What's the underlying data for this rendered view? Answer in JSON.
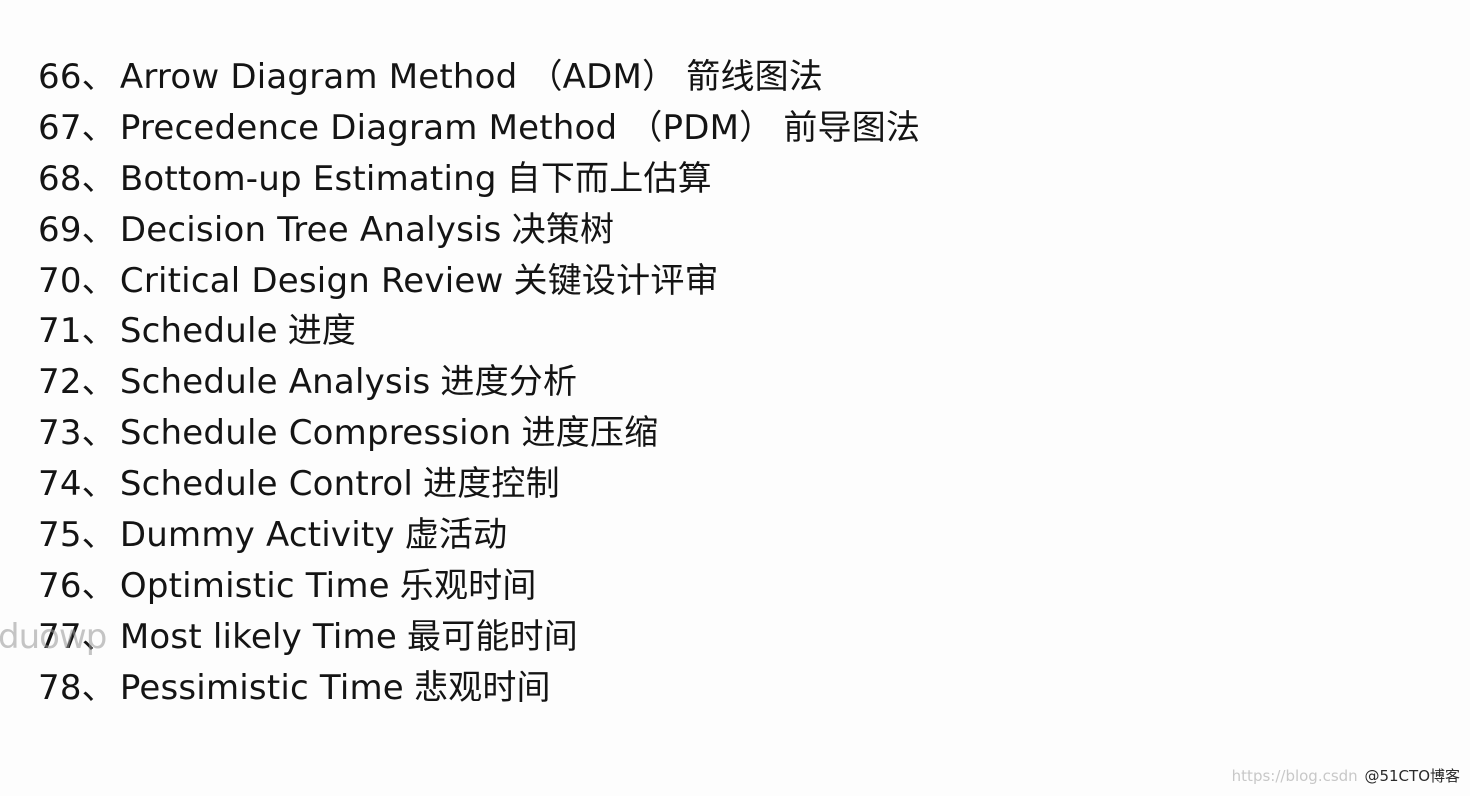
{
  "terms": [
    {
      "num": "66",
      "sep": "、",
      "en": "Arrow Diagram Method （ADM）",
      "zh": "箭线图法"
    },
    {
      "num": "67",
      "sep": "、",
      "en": "Precedence Diagram Method （PDM）",
      "zh": "前导图法"
    },
    {
      "num": "68",
      "sep": "、",
      "en": "Bottom-up Estimating",
      "zh": "自下而上估算"
    },
    {
      "num": "69",
      "sep": "、",
      "en": "Decision Tree Analysis",
      "zh": "决策树"
    },
    {
      "num": "70",
      "sep": "、",
      "en": "Critical Design Review",
      "zh": "关键设计评审"
    },
    {
      "num": "71",
      "sep": "、",
      "en": "Schedule",
      "zh": "进度"
    },
    {
      "num": "72",
      "sep": "、",
      "en": "Schedule Analysis",
      "zh": "进度分析"
    },
    {
      "num": "73",
      "sep": "、",
      "en": "Schedule Compression",
      "zh": "进度压缩"
    },
    {
      "num": "74",
      "sep": "、",
      "en": "Schedule Control",
      "zh": "进度控制"
    },
    {
      "num": "75",
      "sep": "、",
      "en": "Dummy Activity",
      "zh": "虚活动"
    },
    {
      "num": "76",
      "sep": "、",
      "en": "Optimistic Time",
      "zh": "乐观时间"
    },
    {
      "num": "77",
      "sep": "、",
      "en": "Most likely Time",
      "zh": "最可能时间"
    },
    {
      "num": "78",
      "sep": "、",
      "en": "Pessimistic Time",
      "zh": "悲观时间"
    }
  ],
  "watermark": {
    "left_text": "duowp",
    "footer_url": "https://blog.csdn",
    "footer_brand": "@51CTO博客"
  },
  "colors": {
    "text": "#141414",
    "background": "#fdfdfd"
  }
}
